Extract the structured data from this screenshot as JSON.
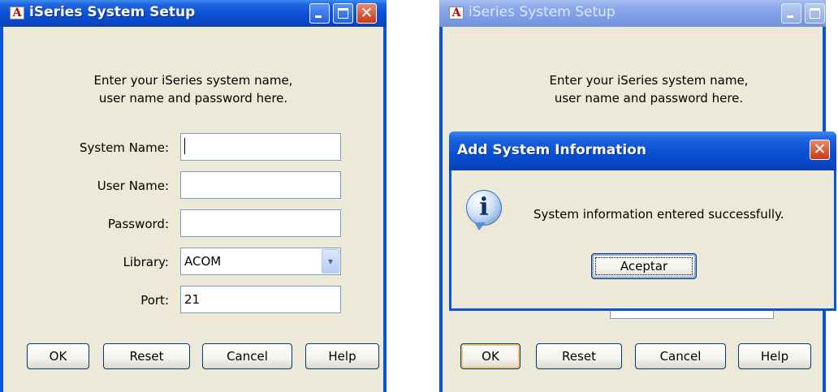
{
  "left_window": {
    "title": "iSeries System Setup",
    "instructions": [
      "Enter your iSeries system name,",
      "user name and password here."
    ],
    "fields": {
      "system_name": {
        "label": "System Name:",
        "value": ""
      },
      "user_name": {
        "label": "User Name:",
        "value": ""
      },
      "password": {
        "label": "Password:",
        "value": ""
      },
      "library": {
        "label": "Library:",
        "value": "ACOM"
      },
      "port": {
        "label": "Port:",
        "value": "21"
      }
    },
    "buttons": {
      "ok": "OK",
      "reset": "Reset",
      "cancel": "Cancel",
      "help": "Help"
    }
  },
  "right_window": {
    "title": "iSeries System Setup",
    "instructions": [
      "Enter your iSeries system name,",
      "user name and password here."
    ],
    "buttons": {
      "ok": "OK",
      "reset": "Reset",
      "cancel": "Cancel",
      "help": "Help"
    }
  },
  "dialog": {
    "title": "Add System Information",
    "message": "System information entered successfully.",
    "button": "Aceptar",
    "icon": "info-icon"
  },
  "icons": {
    "app": "A",
    "close": "✕",
    "dropdown": "▾",
    "info": "i"
  },
  "colors": {
    "titlebar": "#0a53d6",
    "client": "#ece9d8",
    "close_button": "#c33b14"
  }
}
